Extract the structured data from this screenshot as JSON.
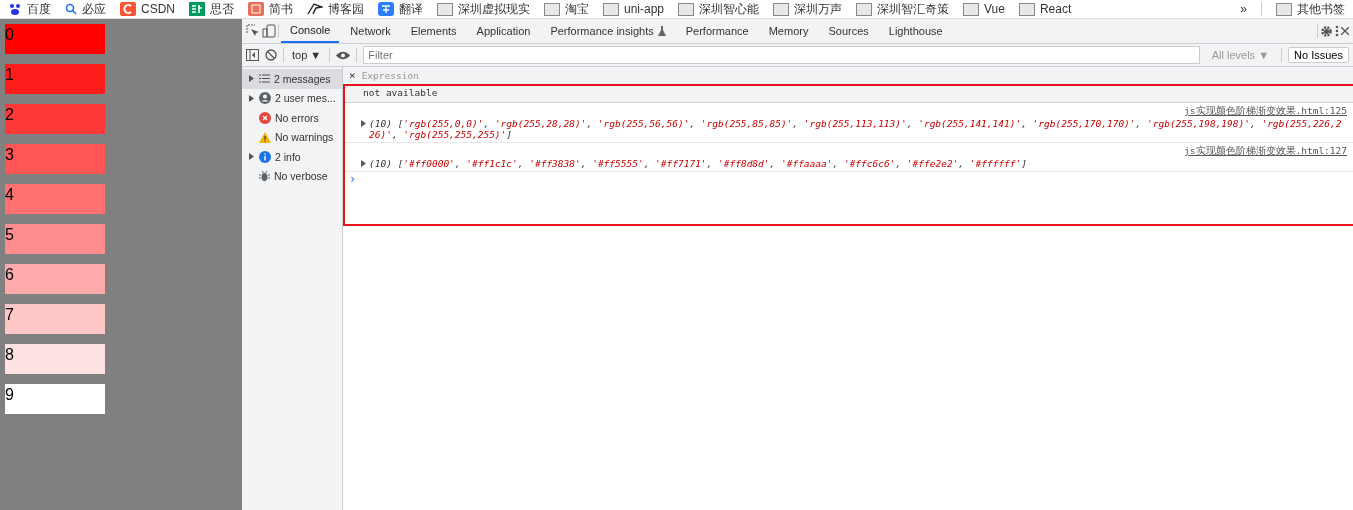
{
  "bookmarks": [
    {
      "label": "百度",
      "kind": "paw"
    },
    {
      "label": "必应",
      "kind": "search"
    },
    {
      "label": "CSDN",
      "kind": "c"
    },
    {
      "label": "思否",
      "kind": "sf"
    },
    {
      "label": "简书",
      "kind": "jian"
    },
    {
      "label": "博客园",
      "kind": "bird"
    },
    {
      "label": "翻译",
      "kind": "translate"
    },
    {
      "label": "深圳虚拟现实",
      "kind": "folder"
    },
    {
      "label": "淘宝",
      "kind": "folder"
    },
    {
      "label": "uni-app",
      "kind": "folder"
    },
    {
      "label": "深圳智心能",
      "kind": "folder"
    },
    {
      "label": "深圳万声",
      "kind": "folder"
    },
    {
      "label": "深圳智汇奇策",
      "kind": "folder"
    },
    {
      "label": "Vue",
      "kind": "folder"
    },
    {
      "label": "React",
      "kind": "folder"
    }
  ],
  "bookmarks_more": "»",
  "other_bookmarks": "其他书签",
  "swatches": [
    {
      "label": "0",
      "color": "#ff0000"
    },
    {
      "label": "1",
      "color": "#ff1c1c"
    },
    {
      "label": "2",
      "color": "#ff3838"
    },
    {
      "label": "3",
      "color": "#ff5555"
    },
    {
      "label": "4",
      "color": "#ff7171"
    },
    {
      "label": "5",
      "color": "#ff8d8d"
    },
    {
      "label": "6",
      "color": "#ffaaaa"
    },
    {
      "label": "7",
      "color": "#ffc6c6"
    },
    {
      "label": "8",
      "color": "#ffe2e2"
    },
    {
      "label": "9",
      "color": "#ffffff"
    }
  ],
  "devtools": {
    "tabs": [
      {
        "label": "Console",
        "selected": true
      },
      {
        "label": "Network",
        "selected": false
      },
      {
        "label": "Elements",
        "selected": false
      },
      {
        "label": "Application",
        "selected": false
      },
      {
        "label": "Performance insights",
        "selected": false,
        "experimental": true
      },
      {
        "label": "Performance",
        "selected": false
      },
      {
        "label": "Memory",
        "selected": false
      },
      {
        "label": "Sources",
        "selected": false
      },
      {
        "label": "Lighthouse",
        "selected": false
      }
    ],
    "context": "top ▼",
    "filter_placeholder": "Filter",
    "levels": "All levels ▼",
    "issues": "No Issues",
    "sidebar": [
      {
        "label": "2 messages",
        "kind": "list",
        "expandable": true,
        "selected": true
      },
      {
        "label": "2 user mes...",
        "kind": "user",
        "expandable": true,
        "selected": false
      },
      {
        "label": "No errors",
        "kind": "error",
        "expandable": false,
        "selected": false
      },
      {
        "label": "No warnings",
        "kind": "warning",
        "expandable": false,
        "selected": false
      },
      {
        "label": "2 info",
        "kind": "info",
        "expandable": true,
        "selected": false
      },
      {
        "label": "No verbose",
        "kind": "verbose",
        "expandable": false,
        "selected": false
      }
    ],
    "expression": {
      "close": "×",
      "placeholder": "Expression",
      "value": "not available"
    },
    "messages": [
      {
        "source": "js实现颜色阶梯渐变效果.html:125",
        "count": "(10)",
        "open": "[",
        "close": "]",
        "separator": ", ",
        "items": [
          "'rgb(255,0,0)'",
          "'rgb(255,28,28)'",
          "'rgb(255,56,56)'",
          "'rgb(255,85,85)'",
          "'rgb(255,113,113)'",
          "'rgb(255,141,141)'",
          "'rgb(255,170,170)'",
          "'rgb(255,198,198)'",
          "'rgb(255,226,226)'",
          "'rgb(255,255,255)'"
        ]
      },
      {
        "source": "js实现颜色阶梯渐变效果.html:127",
        "count": "(10)",
        "open": "[",
        "close": "]",
        "separator": ", ",
        "items": [
          "'#ff0000'",
          "'#ff1c1c'",
          "'#ff3838'",
          "'#ff5555'",
          "'#ff7171'",
          "'#ff8d8d'",
          "'#ffaaaa'",
          "'#ffc6c6'",
          "'#ffe2e2'",
          "'#ffffff'"
        ]
      }
    ],
    "prompt": "›"
  }
}
